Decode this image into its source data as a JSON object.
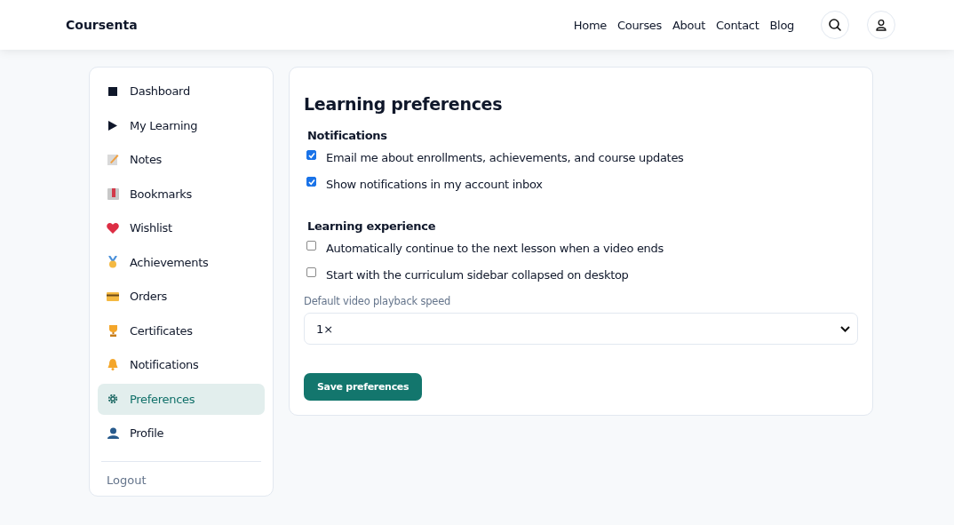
{
  "header": {
    "brand": "Coursenta",
    "nav": [
      {
        "label": "Home"
      },
      {
        "label": "Courses"
      },
      {
        "label": "About"
      },
      {
        "label": "Contact"
      },
      {
        "label": "Blog"
      }
    ]
  },
  "sidebar": {
    "items": [
      {
        "label": "Dashboard",
        "selected": false
      },
      {
        "label": "My Learning",
        "selected": false
      },
      {
        "label": "Notes",
        "selected": false
      },
      {
        "label": "Bookmarks",
        "selected": false
      },
      {
        "label": "Wishlist",
        "selected": false
      },
      {
        "label": "Achievements",
        "selected": false
      },
      {
        "label": "Orders",
        "selected": false
      },
      {
        "label": "Certificates",
        "selected": false
      },
      {
        "label": "Notifications",
        "selected": false
      },
      {
        "label": "Preferences",
        "selected": true
      },
      {
        "label": "Profile",
        "selected": false
      }
    ],
    "logout": "Logout"
  },
  "main": {
    "title": "Learning preferences",
    "sections": [
      {
        "heading": "Notifications",
        "options": [
          {
            "label": "Email me about enrollments, achievements, and course updates",
            "checked": true
          },
          {
            "label": "Show notifications in my account inbox",
            "checked": true
          }
        ]
      },
      {
        "heading": "Learning experience",
        "options": [
          {
            "label": "Automatically continue to the next lesson when a video ends",
            "checked": false
          },
          {
            "label": "Start with the curriculum sidebar collapsed on desktop",
            "checked": false
          }
        ]
      }
    ],
    "speed": {
      "label": "Default video playback speed",
      "value": "1×"
    },
    "save": "Save preferences"
  }
}
